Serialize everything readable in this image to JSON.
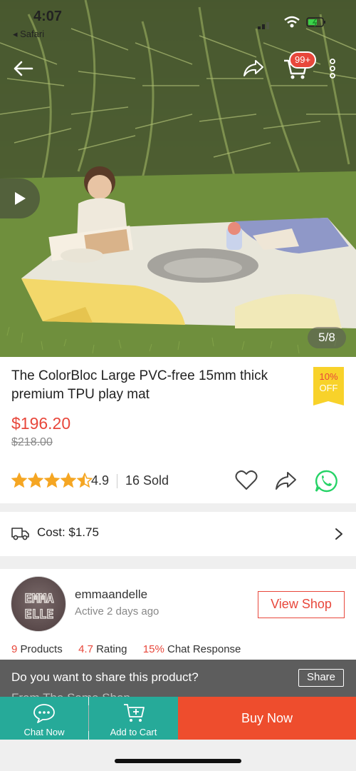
{
  "status_bar": {
    "time": "4:07",
    "back_app": "◂ Safari"
  },
  "gallery": {
    "counter": "5/8",
    "cart_badge": "99+"
  },
  "product": {
    "title": "The ColorBloc Large PVC-free 15mm thick premium TPU play mat",
    "discount_line1": "10%",
    "discount_line2": "OFF",
    "price": "$196.20",
    "original_price": "$218.00",
    "rating": 4.5,
    "rating_text": "4.9",
    "sold": "16 Sold"
  },
  "shipping": {
    "cost_label": "Cost: $1.75"
  },
  "shop": {
    "name": "emmaandelle",
    "active": "Active 2 days ago",
    "avatar_text_top": "EMMA",
    "avatar_text_bottom": "ELLE",
    "view_shop_label": "View Shop",
    "products_count": "9",
    "products_label": "Products",
    "rating_value": "4.7",
    "rating_label": "Rating",
    "chat_value": "15%",
    "chat_label": "Chat Response"
  },
  "share_banner": {
    "question": "Do you want to share this product?",
    "button": "Share",
    "peek_text": "From The Same Shop"
  },
  "actions": {
    "chat_now": "Chat Now",
    "add_to_cart": "Add to Cart",
    "buy_now": "Buy Now"
  },
  "colors": {
    "accent": "#ee4d2d",
    "teal": "#26aa99",
    "star": "#f5a623",
    "whatsapp": "#25d366"
  }
}
